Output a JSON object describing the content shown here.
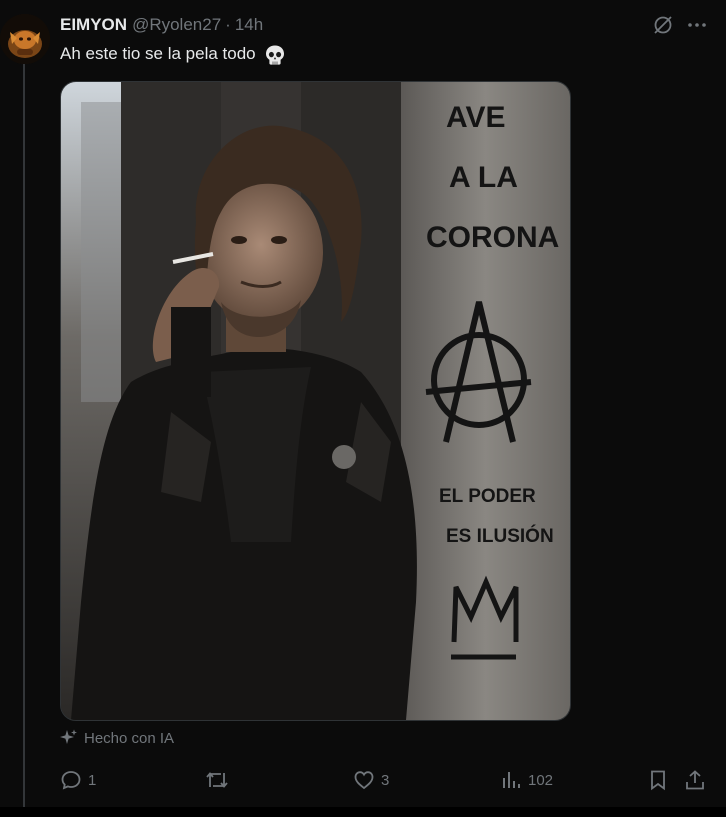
{
  "tweet": {
    "author_name": "EIMYON",
    "handle": "@Ryolen27",
    "separator": "·",
    "time": "14h",
    "text": "Ah este tio se la pela todo",
    "text_emoji": "skull",
    "ai_label": "Hecho con IA"
  },
  "image": {
    "graffiti_lines": [
      "AVE",
      "A LA",
      "CORONA",
      "EL PODER",
      "ES ILUSIÓN"
    ]
  },
  "actions": {
    "replies": "1",
    "retweets": "",
    "likes": "3",
    "views": "102"
  },
  "colors": {
    "background": "#0b0b0b",
    "text_primary": "#e7e9ea",
    "text_secondary": "#71767b",
    "border": "#2f3336"
  },
  "icons": [
    "grok-icon",
    "more-icon",
    "skull-emoji",
    "sparkle-icon",
    "reply-icon",
    "retweet-icon",
    "like-icon",
    "views-icon",
    "bookmark-icon",
    "share-icon"
  ]
}
